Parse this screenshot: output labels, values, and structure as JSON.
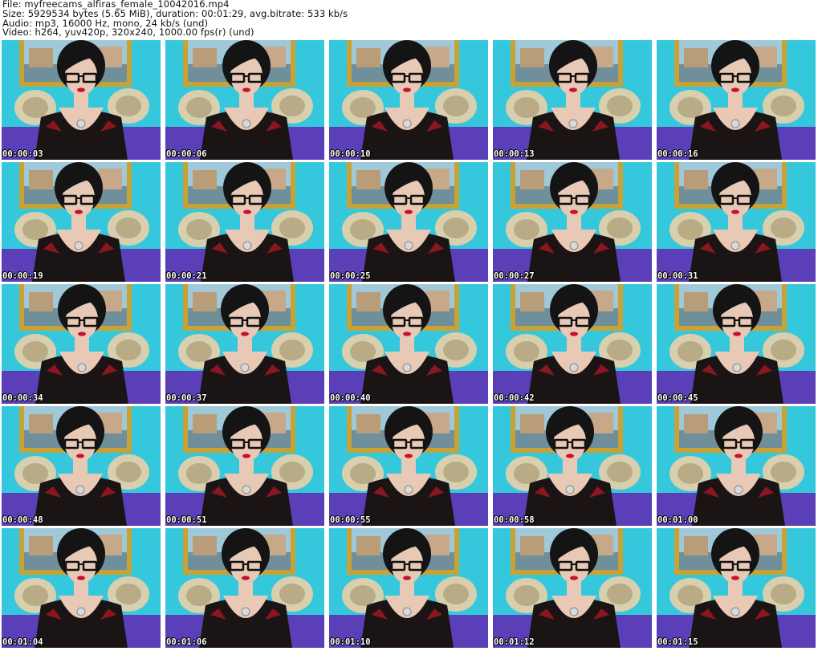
{
  "header": {
    "file_line": "File: myfreecams_alfiras_female_10042016.mp4",
    "size_line": "Size: 5929534 bytes (5.65 MiB), duration: 00:01:29, avg.bitrate: 533 kb/s",
    "audio_line": "Audio: mp3, 16000 Hz, mono, 24 kb/s (und)",
    "video_line": "Video: h264, yuv420p, 320x240, 1000.00 fps(r) (und)"
  },
  "thumbnails": [
    {
      "timestamp": "00:00:03"
    },
    {
      "timestamp": "00:00:06"
    },
    {
      "timestamp": "00:00:10"
    },
    {
      "timestamp": "00:00:13"
    },
    {
      "timestamp": "00:00:16"
    },
    {
      "timestamp": "00:00:19"
    },
    {
      "timestamp": "00:00:21"
    },
    {
      "timestamp": "00:00:25"
    },
    {
      "timestamp": "00:00:27"
    },
    {
      "timestamp": "00:00:31"
    },
    {
      "timestamp": "00:00:34"
    },
    {
      "timestamp": "00:00:37"
    },
    {
      "timestamp": "00:00:40"
    },
    {
      "timestamp": "00:00:42"
    },
    {
      "timestamp": "00:00:45"
    },
    {
      "timestamp": "00:00:48"
    },
    {
      "timestamp": "00:00:51"
    },
    {
      "timestamp": "00:00:55"
    },
    {
      "timestamp": "00:00:58"
    },
    {
      "timestamp": "00:01:00"
    },
    {
      "timestamp": "00:01:04"
    },
    {
      "timestamp": "00:01:06"
    },
    {
      "timestamp": "00:01:10"
    },
    {
      "timestamp": "00:01:12"
    },
    {
      "timestamp": "00:01:15"
    }
  ],
  "colors": {
    "wall": "#35c8dc",
    "frame_gold": "#c9a235",
    "painting_sky": "#9fc8d8",
    "pillow": "#d8cfae",
    "bedspread": "#5a3fb8",
    "hair": "#141414",
    "skin": "#e8c9b6",
    "lips": "#c8102e",
    "dress": "#1a1414",
    "timestamp_text": "#ffffff"
  }
}
